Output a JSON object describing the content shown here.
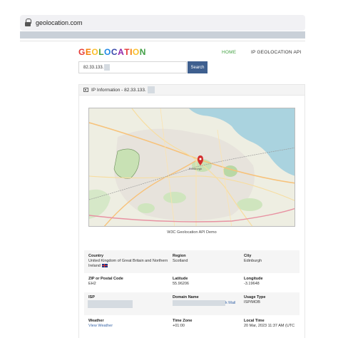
{
  "browser": {
    "url": "geolocation.com"
  },
  "header": {
    "logo_letters": [
      {
        "ch": "G",
        "color": "#e53935"
      },
      {
        "ch": "E",
        "color": "#f57c00"
      },
      {
        "ch": "O",
        "color": "#fbc02d"
      },
      {
        "ch": "L",
        "color": "#43a047"
      },
      {
        "ch": "O",
        "color": "#1e88e5"
      },
      {
        "ch": "C",
        "color": "#3949ab"
      },
      {
        "ch": "A",
        "color": "#8e24aa"
      },
      {
        "ch": "T",
        "color": "#e53935"
      },
      {
        "ch": "I",
        "color": "#f57c00"
      },
      {
        "ch": "O",
        "color": "#fbc02d"
      },
      {
        "ch": "N",
        "color": "#43a047"
      }
    ],
    "nav_home": "HOME",
    "nav_api": "IP GEOLOCATION API",
    "accent": "#44a244"
  },
  "search": {
    "value": "82.33.133.",
    "button": "Search",
    "button_color": "#3e5f8f"
  },
  "panel": {
    "title": "IP Information - 82.33.133."
  },
  "map": {
    "caption": "W3C Geolocation API Demo",
    "labels": [
      "Edinburgh"
    ]
  },
  "details": {
    "country_label": "Country",
    "country_value": "United Kingdom of Great Britain and Northern Ireland",
    "region_label": "Region",
    "region_value": "Scotland",
    "city_label": "City",
    "city_value": "Edinburgh",
    "zip_label": "ZIP or Postal Code",
    "zip_value": "EH2",
    "lat_label": "Latitude",
    "lat_value": "55.96206",
    "lon_label": "Longitude",
    "lon_value": "-3.19648",
    "isp_label": "ISP",
    "domain_label": "Domain Name",
    "domain_partial": "k Mail",
    "usage_label": "Usage Type",
    "usage_value": "ISP/MOB",
    "weather_label": "Weather",
    "weather_link": "View Weather",
    "tz_label": "Time Zone",
    "tz_value": "+01:00",
    "local_label": "Local Time",
    "local_value": "20 Mar, 2023 11:37 AM (UTC"
  }
}
